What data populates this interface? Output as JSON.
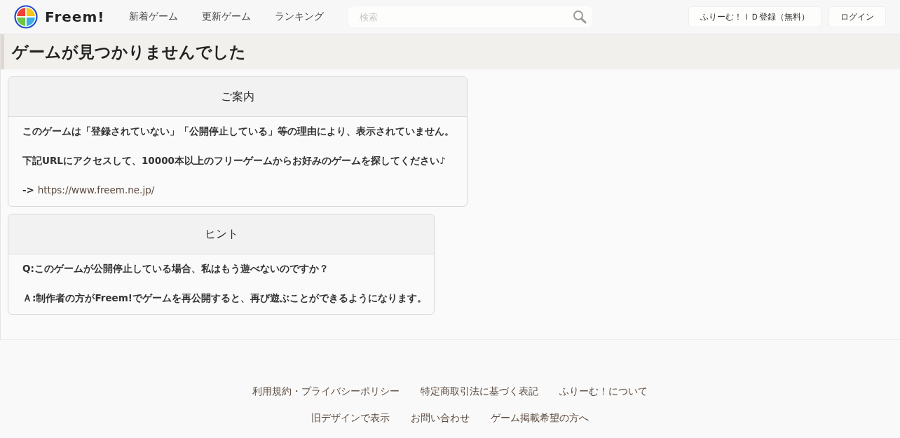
{
  "header": {
    "logo_text": "Freem!",
    "nav": [
      "新着ゲーム",
      "更新ゲーム",
      "ランキング"
    ],
    "search": {
      "placeholder": "検索"
    },
    "buttons": [
      "ふりーむ！ＩＤ登録（無料）",
      "ログイン"
    ]
  },
  "page_title": "ゲームが見つかりませんでした",
  "cards": [
    {
      "title": "ご案内",
      "lines": [
        {
          "kind": "text",
          "text": "このゲームは「登録されていない」「公開停止している」等の理由により、表示されていません。"
        },
        {
          "kind": "text",
          "text": "下記URLにアクセスして、10000本以上のフリーゲームからお好みのゲームを探してください♪"
        },
        {
          "kind": "link",
          "prefix": "->",
          "link": "https://www.freem.ne.jp/"
        }
      ]
    },
    {
      "title": "ヒント",
      "lines": [
        {
          "kind": "text",
          "text": "Q:このゲームが公開停止している場合、私はもう遊べないのですか？"
        },
        {
          "kind": "text",
          "text": "Ａ:制作者の方がFreem!でゲームを再公開すると、再び遊ぶことができるようになります。"
        }
      ]
    }
  ],
  "footer": {
    "rows": [
      [
        "利用規約・プライバシーポリシー",
        "特定商取引法に基づく表記",
        "ふりーむ！について"
      ],
      [
        "旧デザインで表示",
        "お問い合わせ",
        "ゲーム掲載希望の方へ"
      ]
    ]
  }
}
